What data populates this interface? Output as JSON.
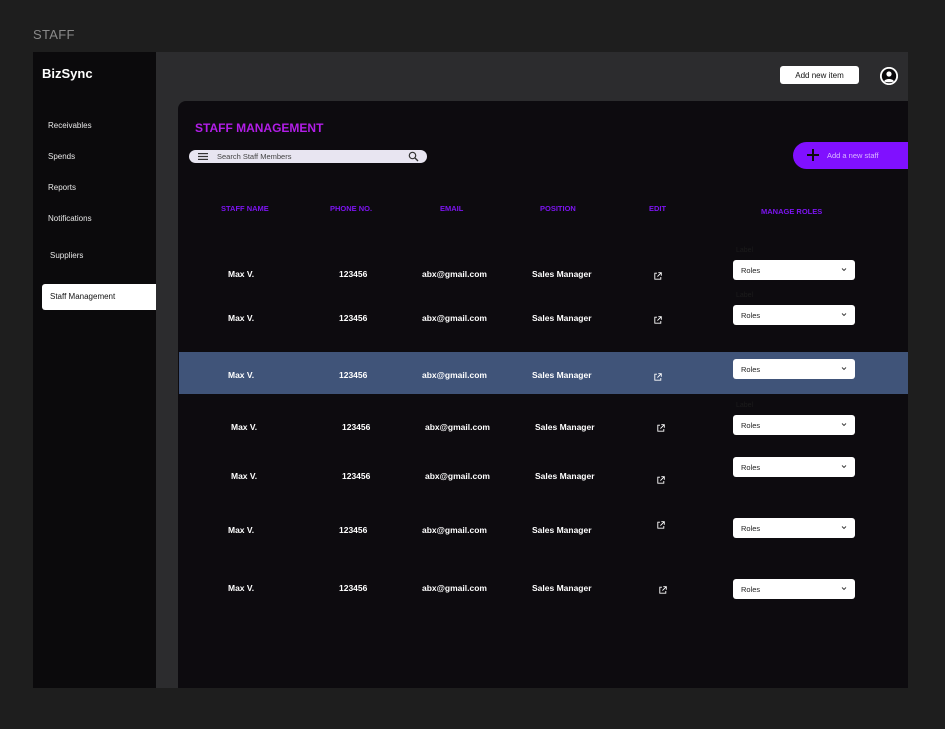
{
  "frame_label": "STAFF",
  "sidebar": {
    "brand": "BizSync",
    "items": [
      {
        "label": "Receivables"
      },
      {
        "label": "Spends"
      },
      {
        "label": "Reports"
      },
      {
        "label": "Notifications"
      },
      {
        "label": "Suppliers"
      },
      {
        "label": "Staff Management",
        "active": true
      }
    ]
  },
  "topbar": {
    "add_item_label": "Add new item",
    "avatar_icon": "user-circle-icon"
  },
  "panel": {
    "title": "STAFF MANAGEMENT",
    "search": {
      "placeholder": "Search Staff Members"
    },
    "add_staff_label": "Add a new staff",
    "columns": [
      "STAFF NAME",
      "PHONE NO.",
      "EMAIL",
      "POSITION",
      "EDIT",
      "MANAGE ROLES"
    ],
    "roles_label": "Label",
    "rows": [
      {
        "name": "Max V.",
        "phone": "123456",
        "email": "abx@gmail.com",
        "position": "Sales Manager",
        "role": "Roles"
      },
      {
        "name": "Max V.",
        "phone": "123456",
        "email": "abx@gmail.com",
        "position": "Sales Manager",
        "role": "Roles"
      },
      {
        "name": "Max V.",
        "phone": "123456",
        "email": "abx@gmail.com",
        "position": "Sales Manager",
        "role": "Roles"
      },
      {
        "name": "Max V.",
        "phone": "123456",
        "email": "abx@gmail.com",
        "position": "Sales Manager",
        "role": "Roles"
      },
      {
        "name": "Max V.",
        "phone": "123456",
        "email": "abx@gmail.com",
        "position": "Sales Manager",
        "role": "Roles"
      },
      {
        "name": "Max V.",
        "phone": "123456",
        "email": "abx@gmail.com",
        "position": "Sales Manager",
        "role": "Roles"
      },
      {
        "name": "Max V.",
        "phone": "123456",
        "email": "abx@gmail.com",
        "position": "Sales Manager",
        "role": "Roles"
      }
    ]
  },
  "colors": {
    "accent_purple": "#8010ff",
    "title_purple": "#b21ee8",
    "header_purple": "#7c14f0",
    "row_highlight": "#405479"
  }
}
